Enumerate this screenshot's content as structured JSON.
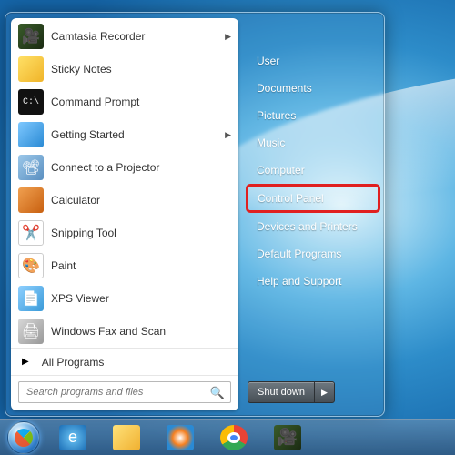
{
  "start_menu": {
    "programs": [
      {
        "label": "Camtasia Recorder",
        "icon": "camtasia-icon",
        "has_submenu": true
      },
      {
        "label": "Sticky Notes",
        "icon": "sticky-notes-icon",
        "has_submenu": false
      },
      {
        "label": "Command Prompt",
        "icon": "cmd-icon",
        "has_submenu": false
      },
      {
        "label": "Getting Started",
        "icon": "getting-started-icon",
        "has_submenu": true
      },
      {
        "label": "Connect to a Projector",
        "icon": "projector-icon",
        "has_submenu": false
      },
      {
        "label": "Calculator",
        "icon": "calculator-icon",
        "has_submenu": false
      },
      {
        "label": "Snipping Tool",
        "icon": "snipping-tool-icon",
        "has_submenu": false
      },
      {
        "label": "Paint",
        "icon": "paint-icon",
        "has_submenu": false
      },
      {
        "label": "XPS Viewer",
        "icon": "xps-viewer-icon",
        "has_submenu": false
      },
      {
        "label": "Windows Fax and Scan",
        "icon": "fax-scan-icon",
        "has_submenu": false
      }
    ],
    "all_programs_label": "All Programs",
    "search_placeholder": "Search programs and files",
    "right_items": [
      {
        "label": "User"
      },
      {
        "label": "Documents"
      },
      {
        "label": "Pictures"
      },
      {
        "label": "Music"
      },
      {
        "label": "Computer"
      },
      {
        "label": "Control Panel",
        "annotated": true
      },
      {
        "label": "Devices and Printers"
      },
      {
        "label": "Default Programs"
      },
      {
        "label": "Help and Support"
      }
    ],
    "shutdown_label": "Shut down"
  },
  "taskbar": {
    "items": [
      {
        "name": "ie-icon"
      },
      {
        "name": "explorer-icon"
      },
      {
        "name": "wmp-icon"
      },
      {
        "name": "chrome-icon"
      },
      {
        "name": "camtasia-task-icon"
      }
    ]
  },
  "colors": {
    "annotation_red": "#e02020"
  }
}
